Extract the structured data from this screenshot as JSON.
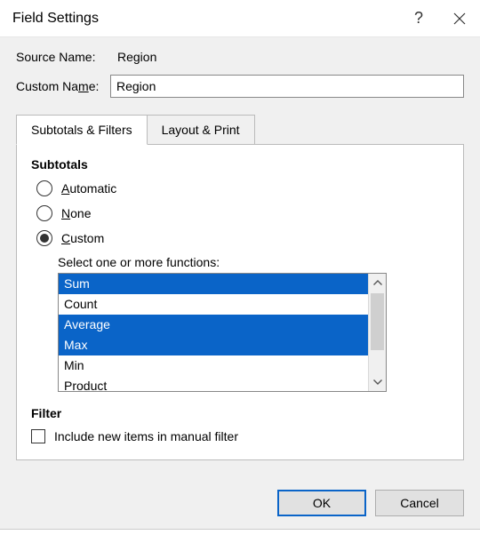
{
  "title": "Field Settings",
  "source_name_label": "Source Name:",
  "source_name_value": "Region",
  "custom_name_label_pre": "Custom Na",
  "custom_name_label_u": "m",
  "custom_name_label_post": "e:",
  "custom_name_value": "Region",
  "tabs": {
    "subtotals": "Subtotals & Filters",
    "layout": "Layout & Print"
  },
  "subtotals_header": "Subtotals",
  "radios": {
    "automatic_u": "A",
    "automatic_rest": "utomatic",
    "none_u": "N",
    "none_rest": "one",
    "custom_u": "C",
    "custom_rest": "ustom"
  },
  "functions_label": "Select one or more functions:",
  "functions": [
    {
      "label": "Sum",
      "selected": true
    },
    {
      "label": "Count",
      "selected": false
    },
    {
      "label": "Average",
      "selected": true
    },
    {
      "label": "Max",
      "selected": true
    },
    {
      "label": "Min",
      "selected": false
    },
    {
      "label": "Product",
      "selected": false
    }
  ],
  "filter_header": "Filter",
  "include_new_items": "Include new items in manual filter",
  "ok": "OK",
  "cancel": "Cancel"
}
